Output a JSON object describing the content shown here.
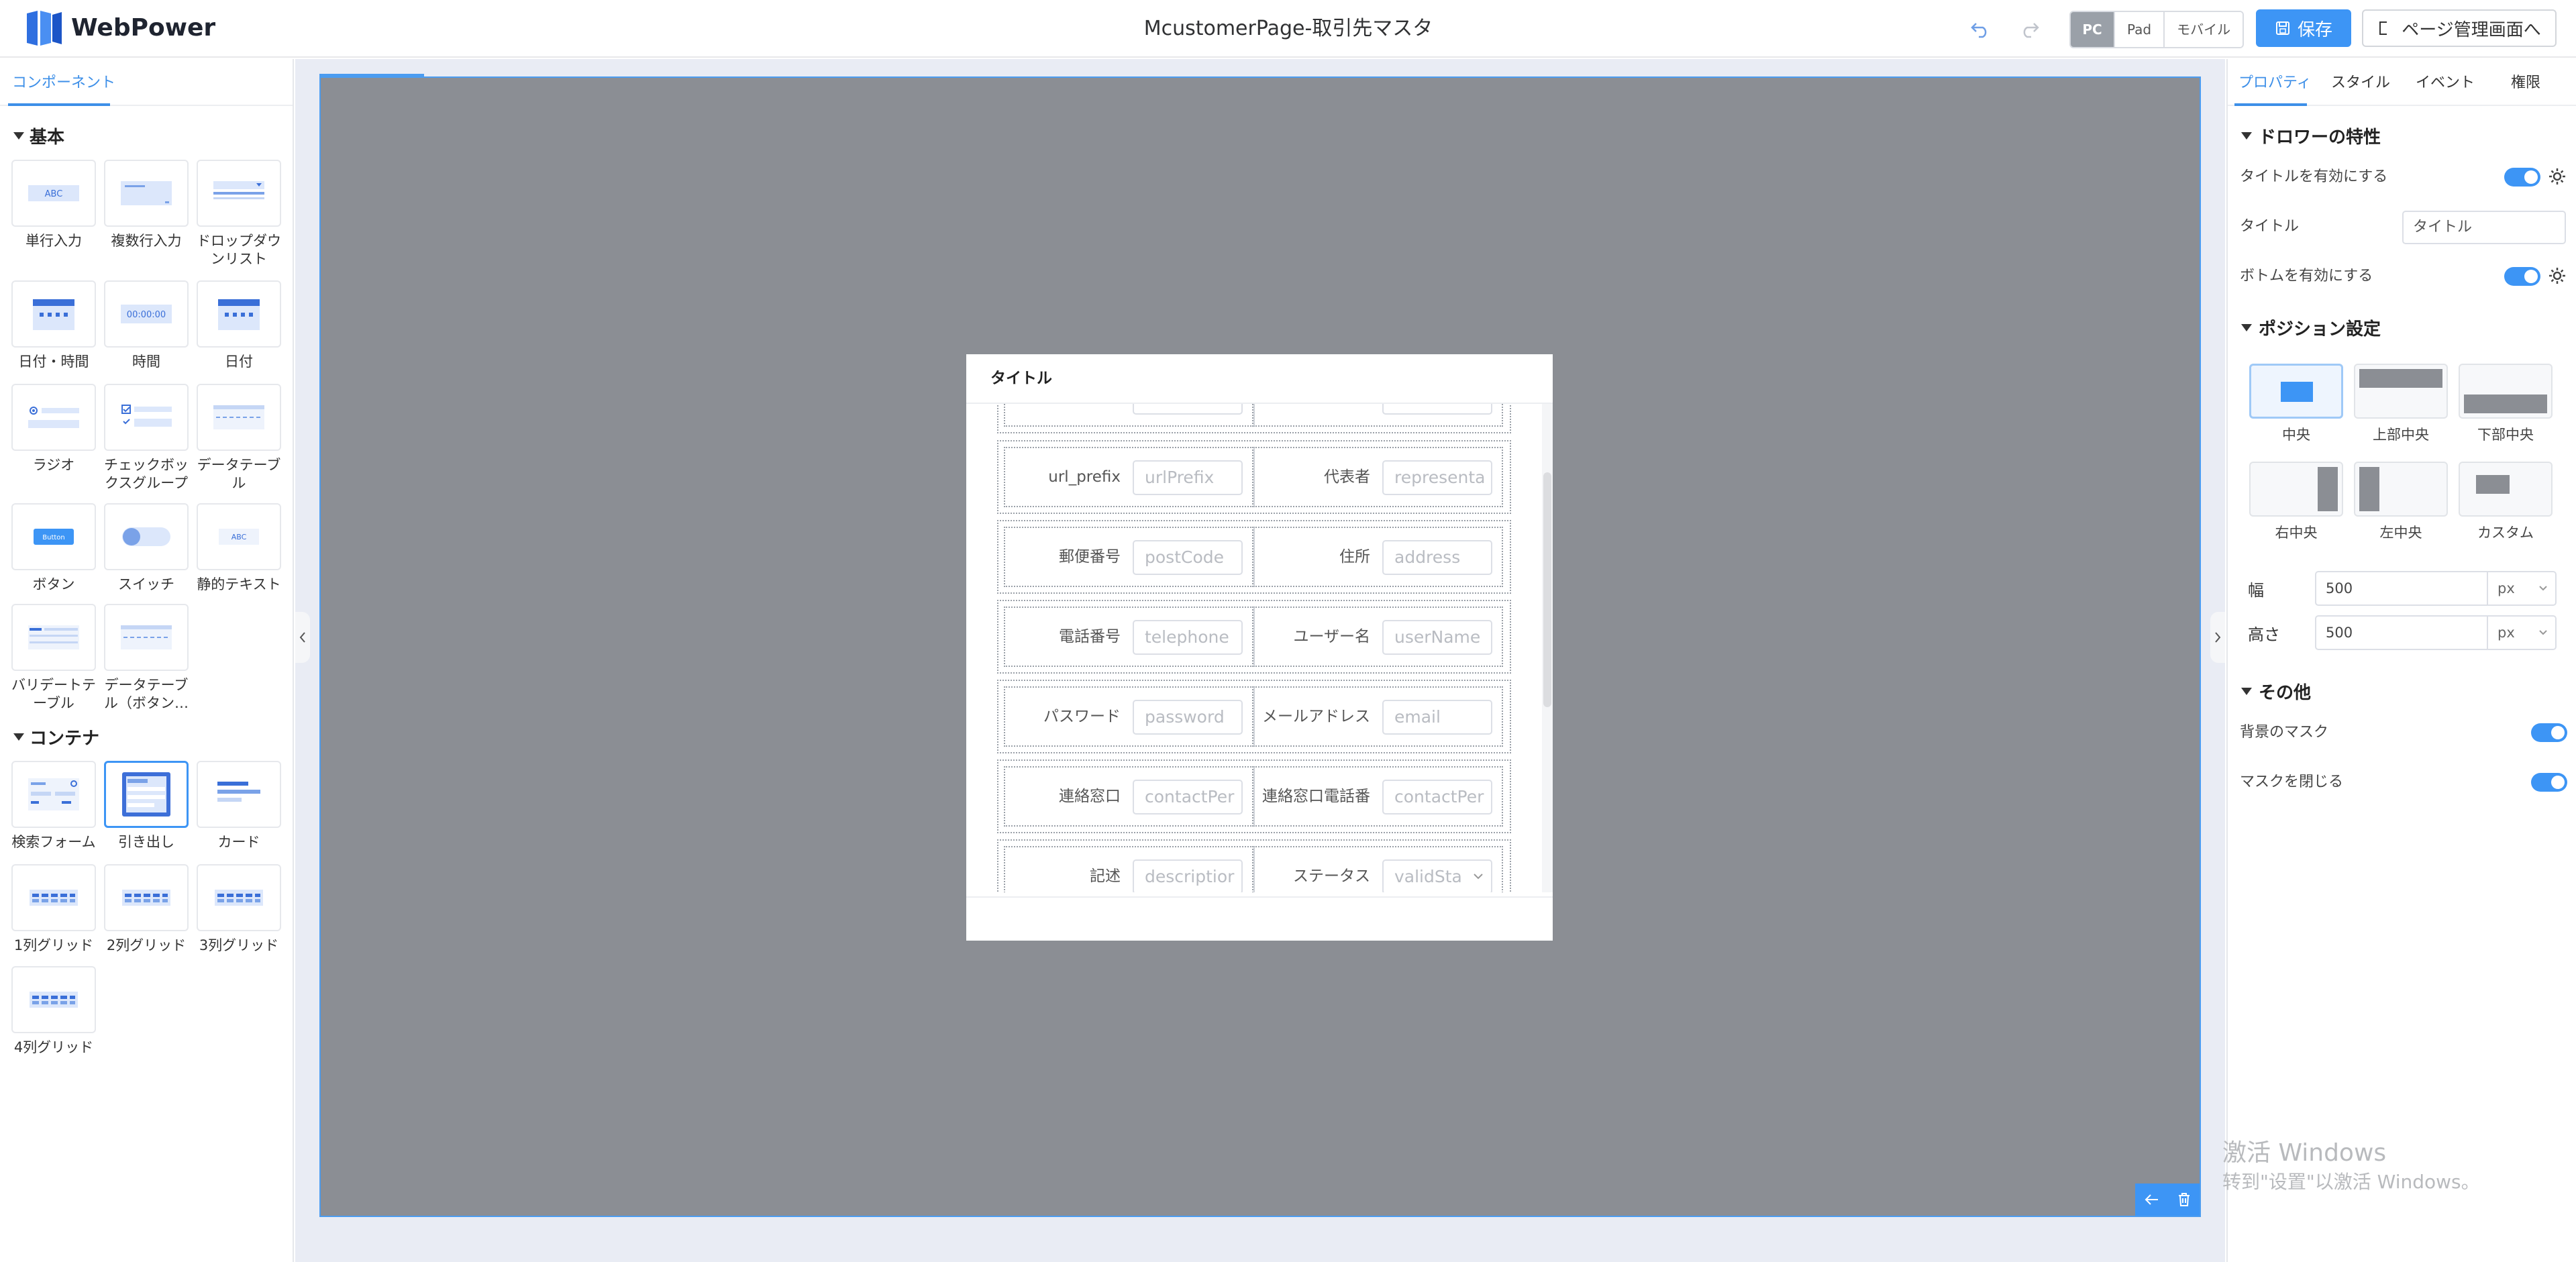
{
  "app": {
    "logo_text": "WebPower",
    "page_title": "McustomerPage-取引先マスタ"
  },
  "header": {
    "devices": [
      "PC",
      "Pad",
      "モバイル"
    ],
    "save_label": "保存",
    "back_label": "ページ管理画面へ"
  },
  "left_panel": {
    "tab": "コンポーネント",
    "sections": {
      "basic": "基本",
      "container": "コンテナ"
    },
    "basic_items": [
      "単行入力",
      "複数行入力",
      "ドロップダウンリスト",
      "日付・時間",
      "時間",
      "日付",
      "ラジオ",
      "チェックボックスグループ",
      "データテーブル",
      "ボタン",
      "スイッチ",
      "静的テキスト",
      "バリデートテーブル",
      "データテーブル（ボタン…"
    ],
    "container_items": [
      "検索フォーム",
      "引き出し",
      "カード",
      "1列グリッド",
      "2列グリッド",
      "3列グリッド",
      "4列グリッド"
    ],
    "tile_text": {
      "abc": "ABC",
      "time": "00:00:00",
      "button": "Button"
    }
  },
  "drawer": {
    "title": "タイトル",
    "rows": [
      {
        "l1": "url_prefix",
        "p1": "urlPrefix",
        "l2": "代表者",
        "p2": "representa"
      },
      {
        "l1": "郵便番号",
        "p1": "postCode",
        "l2": "住所",
        "p2": "address"
      },
      {
        "l1": "電話番号",
        "p1": "telephone",
        "l2": "ユーザー名",
        "p2": "userName"
      },
      {
        "l1": "パスワード",
        "p1": "password",
        "l2": "メールアドレス",
        "p2": "email"
      },
      {
        "l1": "連絡窓口",
        "p1": "contactPer",
        "l2": "連絡窓口電話番",
        "p2": "contactPer"
      },
      {
        "l1": "記述",
        "p1": "descriptior",
        "l2": "ステータス",
        "p2": "validSta"
      }
    ]
  },
  "right_panel": {
    "tabs": [
      "プロパティ",
      "スタイル",
      "イベント",
      "権限"
    ],
    "drawer_props": {
      "section": "ドロワーの特性",
      "enable_title": "タイトルを有効にする",
      "title_label": "タイトル",
      "title_value": "タイトル",
      "enable_bottom": "ボトムを有効にする"
    },
    "position": {
      "section": "ポジション設定",
      "options": [
        "中央",
        "上部中央",
        "下部中央",
        "右中央",
        "左中央",
        "カスタム"
      ],
      "selected": "中央",
      "width_label": "幅",
      "width_value": "500",
      "height_label": "高さ",
      "height_value": "500",
      "unit": "px"
    },
    "other": {
      "section": "その他",
      "bg_mask": "背景のマスク",
      "close_mask": "マスクを閉じる"
    }
  },
  "watermark": {
    "line1": "激活 Windows",
    "line2": "转到\"设置\"以激活 Windows。"
  },
  "colors": {
    "accent": "#3d95f5",
    "stage": "#8b8e94",
    "canvas_bg": "#e9ecf4"
  }
}
